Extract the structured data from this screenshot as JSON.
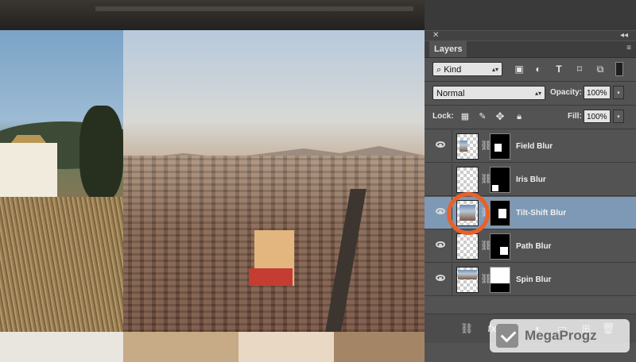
{
  "panel": {
    "tab_label": "Layers",
    "close_glyph": "✕",
    "collapse_glyph": "◂◂",
    "menu_glyph": "≡",
    "filter": {
      "kind_label": "Kind",
      "icons": [
        "image-filter-icon",
        "adjustment-filter-icon",
        "type-filter-icon",
        "shape-filter-icon",
        "smart-object-filter-icon"
      ]
    },
    "blend": {
      "mode": "Normal",
      "opacity_label": "Opacity:",
      "opacity_value": "100%"
    },
    "lock": {
      "label": "Lock:",
      "fill_label": "Fill:",
      "fill_value": "100%"
    },
    "layers": [
      {
        "name": "Field Blur",
        "visible": true,
        "selected": false
      },
      {
        "name": "Iris Blur",
        "visible": false,
        "selected": false
      },
      {
        "name": "Tilt-Shift Blur",
        "visible": true,
        "selected": true
      },
      {
        "name": "Path Blur",
        "visible": true,
        "selected": false
      },
      {
        "name": "Spin Blur",
        "visible": true,
        "selected": false
      }
    ],
    "bottom_icons": [
      "link-layers-icon",
      "fx-icon",
      "add-mask-icon",
      "adjustment-layer-icon",
      "new-group-icon",
      "new-layer-icon",
      "trash-icon"
    ]
  },
  "watermark": {
    "text": "MegaProgz"
  },
  "colors": {
    "selected_layer": "#7e99b5",
    "highlight_circle": "#e8612a",
    "panel_bg": "#535353"
  }
}
